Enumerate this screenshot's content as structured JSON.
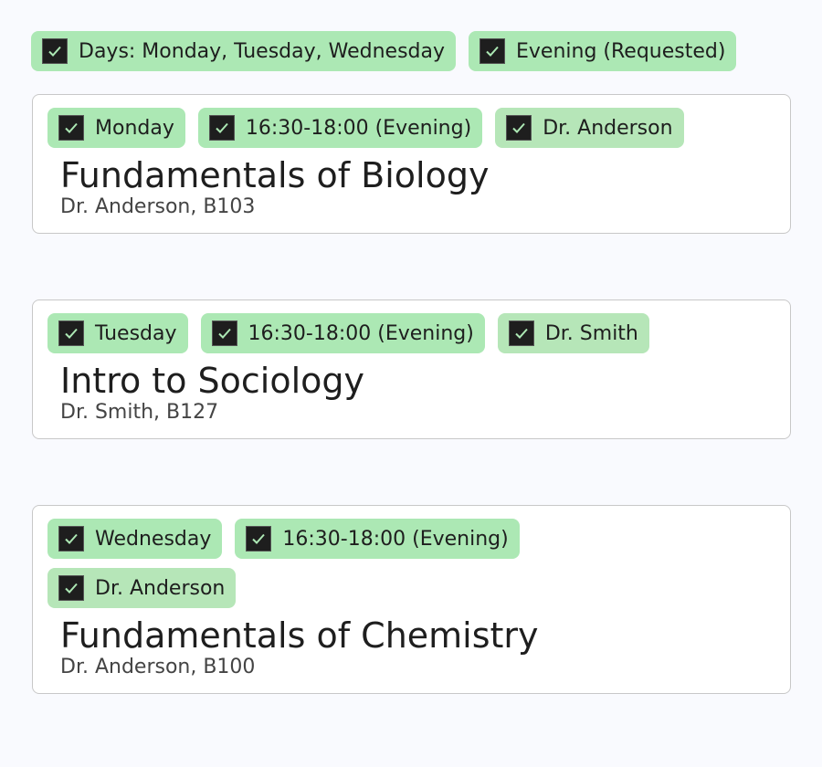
{
  "filters": [
    {
      "label": "Days: Monday, Tuesday, Wednesday",
      "checked": true
    },
    {
      "label": "Evening (Requested)",
      "checked": true
    }
  ],
  "courses": [
    {
      "chips": [
        "Monday",
        "16:30-18:00 (Evening)",
        "Dr. Anderson"
      ],
      "title": "Fundamentals of Biology",
      "subtitle": "Dr. Anderson, B103"
    },
    {
      "chips": [
        "Tuesday",
        "16:30-18:00 (Evening)",
        "Dr. Smith"
      ],
      "title": "Intro to Sociology",
      "subtitle": "Dr. Smith, B127"
    },
    {
      "chips": [
        "Wednesday",
        "16:30-18:00 (Evening)",
        "Dr. Anderson"
      ],
      "title": "Fundamentals of Chemistry",
      "subtitle": "Dr. Anderson, B100"
    }
  ],
  "colors": {
    "chip": "#ace8b4",
    "check": "#ace8b4"
  }
}
